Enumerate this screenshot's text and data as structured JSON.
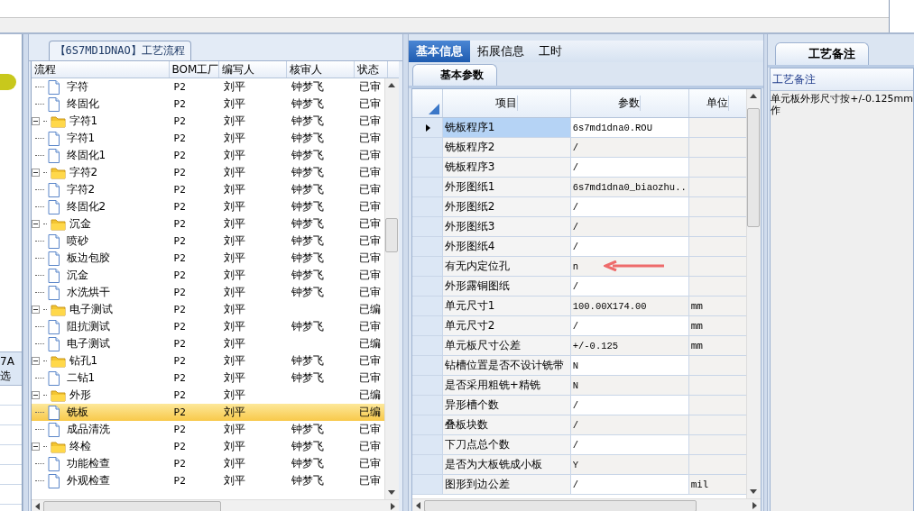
{
  "left_panel": {
    "texts": [
      "7A",
      "选"
    ]
  },
  "process_tree": {
    "title": "【6S7MD1DNAO】工艺流程",
    "columns": [
      "流程",
      "BOM工厂",
      "编写人",
      "核审人",
      "状态"
    ],
    "rows": [
      {
        "kind": "step",
        "name": "字符",
        "bom": "P2",
        "author": "刘平",
        "reviewer": "钟梦飞",
        "status": "已审",
        "selected": false
      },
      {
        "kind": "step",
        "name": "终固化",
        "bom": "P2",
        "author": "刘平",
        "reviewer": "钟梦飞",
        "status": "已审",
        "selected": false
      },
      {
        "kind": "folder",
        "expanded": true,
        "name": "字符1",
        "bom": "P2",
        "author": "刘平",
        "reviewer": "钟梦飞",
        "status": "已审",
        "selected": false,
        "children": [
          {
            "kind": "step",
            "name": "字符1",
            "bom": "P2",
            "author": "刘平",
            "reviewer": "钟梦飞",
            "status": "已审",
            "selected": false
          },
          {
            "kind": "step",
            "name": "终固化1",
            "bom": "P2",
            "author": "刘平",
            "reviewer": "钟梦飞",
            "status": "已审",
            "selected": false
          }
        ]
      },
      {
        "kind": "folder",
        "expanded": true,
        "name": "字符2",
        "bom": "P2",
        "author": "刘平",
        "reviewer": "钟梦飞",
        "status": "已审",
        "selected": false,
        "children": [
          {
            "kind": "step",
            "name": "字符2",
            "bom": "P2",
            "author": "刘平",
            "reviewer": "钟梦飞",
            "status": "已审",
            "selected": false
          },
          {
            "kind": "step",
            "name": "终固化2",
            "bom": "P2",
            "author": "刘平",
            "reviewer": "钟梦飞",
            "status": "已审",
            "selected": false
          }
        ]
      },
      {
        "kind": "folder",
        "expanded": true,
        "name": "沉金",
        "bom": "P2",
        "author": "刘平",
        "reviewer": "钟梦飞",
        "status": "已审",
        "selected": false,
        "children": [
          {
            "kind": "step",
            "name": "喷砂",
            "bom": "P2",
            "author": "刘平",
            "reviewer": "钟梦飞",
            "status": "已审",
            "selected": false
          },
          {
            "kind": "step",
            "name": "板边包胶",
            "bom": "P2",
            "author": "刘平",
            "reviewer": "钟梦飞",
            "status": "已审",
            "selected": false
          },
          {
            "kind": "step",
            "name": "沉金",
            "bom": "P2",
            "author": "刘平",
            "reviewer": "钟梦飞",
            "status": "已审",
            "selected": false
          },
          {
            "kind": "step",
            "name": "水洗烘干",
            "bom": "P2",
            "author": "刘平",
            "reviewer": "钟梦飞",
            "status": "已审",
            "selected": false
          }
        ]
      },
      {
        "kind": "folder",
        "expanded": true,
        "name": "电子测试",
        "bom": "P2",
        "author": "刘平",
        "status": "已编",
        "selected": false,
        "children": [
          {
            "kind": "step",
            "name": "阻抗测试",
            "bom": "P2",
            "author": "刘平",
            "reviewer": "钟梦飞",
            "status": "已审",
            "selected": false
          },
          {
            "kind": "step",
            "name": "电子测试",
            "bom": "P2",
            "author": "刘平",
            "status": "已编",
            "selected": false
          }
        ]
      },
      {
        "kind": "folder",
        "expanded": true,
        "name": "钻孔1",
        "bom": "P2",
        "author": "刘平",
        "reviewer": "钟梦飞",
        "status": "已审",
        "selected": false,
        "children": [
          {
            "kind": "step",
            "name": "二钻1",
            "bom": "P2",
            "author": "刘平",
            "reviewer": "钟梦飞",
            "status": "已审",
            "selected": false
          }
        ]
      },
      {
        "kind": "folder",
        "expanded": true,
        "name": "外形",
        "bom": "P2",
        "author": "刘平",
        "status": "已编",
        "selected": false,
        "children": [
          {
            "kind": "step",
            "name": "铣板",
            "bom": "P2",
            "author": "刘平",
            "status": "已编",
            "selected": true
          },
          {
            "kind": "step",
            "name": "成品清洗",
            "bom": "P2",
            "author": "刘平",
            "reviewer": "钟梦飞",
            "status": "已审",
            "selected": false
          }
        ]
      },
      {
        "kind": "folder",
        "expanded": true,
        "name": "终检",
        "bom": "P2",
        "author": "刘平",
        "reviewer": "钟梦飞",
        "status": "已审",
        "selected": false,
        "children": [
          {
            "kind": "step",
            "name": "功能检查",
            "bom": "P2",
            "author": "刘平",
            "reviewer": "钟梦飞",
            "status": "已审",
            "selected": false
          },
          {
            "kind": "step",
            "name": "外观检查",
            "bom": "P2",
            "author": "刘平",
            "reviewer": "钟梦飞",
            "status": "已审",
            "selected": false
          }
        ]
      }
    ]
  },
  "detail": {
    "tabs": [
      {
        "label": "基本信息",
        "selected": true
      },
      {
        "label": "拓展信息",
        "selected": false
      },
      {
        "label": "工时",
        "selected": false
      }
    ],
    "subtab": "基本参数",
    "columns": [
      "项目",
      "参数",
      "单位"
    ],
    "rows": [
      {
        "item": "铣板程序1",
        "value": "6s7md1dna0.ROU",
        "selected": true
      },
      {
        "item": "铣板程序2",
        "value": "/",
        "selected": false
      },
      {
        "item": "铣板程序3",
        "value": "/",
        "selected": false
      },
      {
        "item": "外形图纸1",
        "value": "6s7md1dna0_biaozhu...",
        "selected": false
      },
      {
        "item": "外形图纸2",
        "value": "/",
        "selected": false
      },
      {
        "item": "外形图纸3",
        "value": "/",
        "selected": false
      },
      {
        "item": "外形图纸4",
        "value": "/",
        "selected": false
      },
      {
        "item": "有无内定位孔",
        "value": "n",
        "selected": false
      },
      {
        "item": "外形露铜图纸",
        "value": "/",
        "selected": false
      },
      {
        "item": "单元尺寸1",
        "value": "100.00X174.00",
        "unit": "mm",
        "selected": false
      },
      {
        "item": "单元尺寸2",
        "value": "/",
        "unit": "mm",
        "selected": false
      },
      {
        "item": "单元板尺寸公差",
        "value": "+/-0.125",
        "unit": "mm",
        "selected": false
      },
      {
        "item": "钻槽位置是否不设计铣带",
        "value": "N",
        "selected": false
      },
      {
        "item": "是否采用粗铣+精铣",
        "value": "N",
        "selected": false
      },
      {
        "item": "异形槽个数",
        "value": "/",
        "selected": false
      },
      {
        "item": "叠板块数",
        "value": "/",
        "selected": false
      },
      {
        "item": "下刀点总个数",
        "value": "/",
        "selected": false
      },
      {
        "item": "是否为大板铣成小板",
        "value": "Y",
        "selected": false
      },
      {
        "item": "图形到边公差",
        "value": "/",
        "unit": "mil",
        "selected": false
      }
    ]
  },
  "remarks": {
    "tab": "工艺备注",
    "header": "工艺备注",
    "lines": [
      "单元板外形尺寸按+/-0.125mm",
      "作"
    ]
  }
}
